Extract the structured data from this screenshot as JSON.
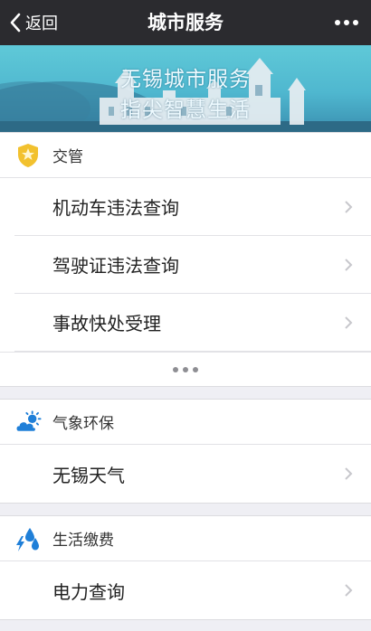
{
  "navbar": {
    "back_label": "返回",
    "title": "城市服务"
  },
  "banner": {
    "line1": "无锡城市服务",
    "line2": "指尖智慧生活"
  },
  "sections": [
    {
      "title": "交管",
      "icon": "police-badge-icon",
      "items": [
        "机动车违法查询",
        "驾驶证违法查询",
        "事故快处受理"
      ]
    },
    {
      "title": "气象环保",
      "icon": "weather-cloud-sun-icon",
      "items": [
        "无锡天气"
      ]
    },
    {
      "title": "生活缴费",
      "icon": "utilities-bolt-drop-icon",
      "items": [
        "电力查询"
      ]
    }
  ],
  "colors": {
    "navbar_bg": "#2b2b2f",
    "banner_bg": "#4fb7cf",
    "badge_gold": "#f2c12e",
    "icon_blue": "#1f7fd8"
  }
}
